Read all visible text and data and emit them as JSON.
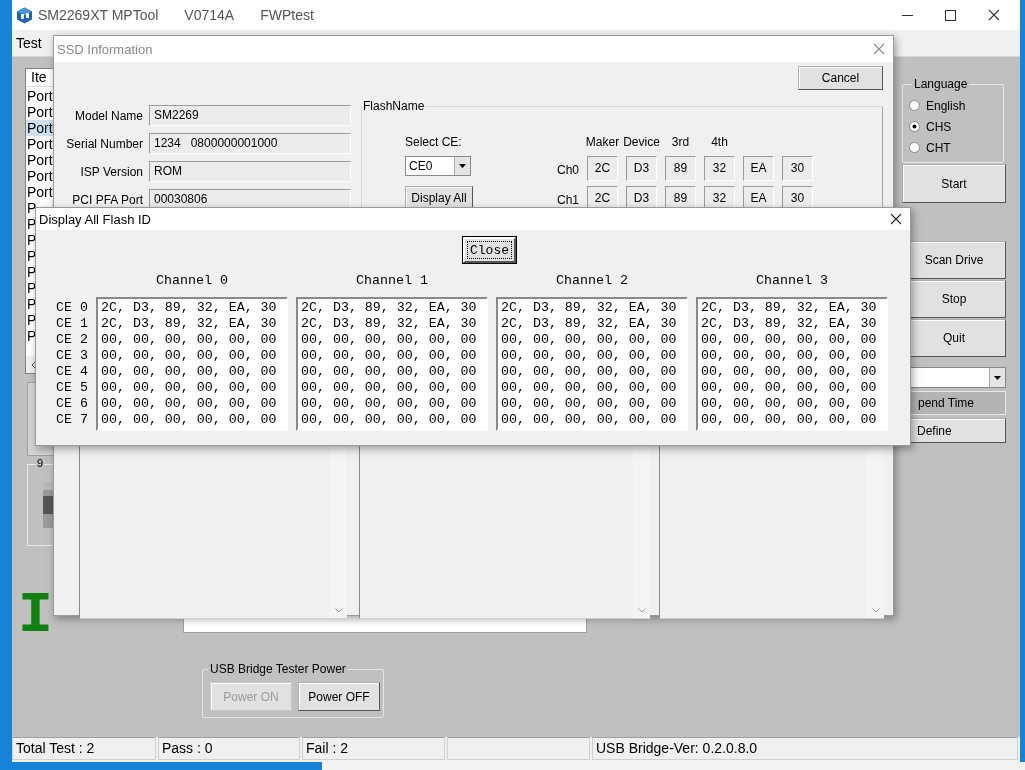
{
  "main_window": {
    "title": "SM2269XT MPTool",
    "version": "V0714A",
    "firmware": "FWPtest",
    "menu": [
      "Test"
    ],
    "port_list": {
      "header": "Ite",
      "rows": [
        {
          "label": "Port",
          "selected": false
        },
        {
          "label": "Port",
          "selected": false
        },
        {
          "label": "Port",
          "selected": true
        },
        {
          "label": "Port",
          "selected": false
        },
        {
          "label": "Port",
          "selected": false
        },
        {
          "label": "Port",
          "selected": false
        },
        {
          "label": "Port",
          "selected": false
        },
        {
          "label": "P",
          "selected": false
        },
        {
          "label": "P",
          "selected": false
        },
        {
          "label": "P",
          "selected": false
        },
        {
          "label": "P",
          "selected": false
        },
        {
          "label": "P",
          "selected": false
        },
        {
          "label": "P",
          "selected": false
        },
        {
          "label": "P",
          "selected": false
        },
        {
          "label": "P",
          "selected": false
        },
        {
          "label": "P",
          "selected": false
        }
      ]
    },
    "slot_group": {
      "label": "9"
    },
    "banner": "I",
    "usb_power": {
      "title": "USB Bridge Tester Power",
      "buttons": [
        {
          "label": "Power ON",
          "disabled": true
        },
        {
          "label": "Power OFF",
          "disabled": false
        }
      ]
    },
    "language": {
      "title": "Language",
      "options": [
        {
          "label": "English",
          "selected": false
        },
        {
          "label": "CHS",
          "selected": true
        },
        {
          "label": "CHT",
          "selected": false
        }
      ]
    },
    "start_button": "Start",
    "buttons": [
      "Scan Drive",
      "Stop",
      "Quit"
    ],
    "spend_time": "pend Time",
    "define_button": "Define"
  },
  "ssd_dialog": {
    "title": "SSD Information",
    "cancel": "Cancel",
    "fields": [
      {
        "label": "Model Name",
        "value": "SM2269"
      },
      {
        "label": "Serial Number",
        "value": "1234   0800000001000"
      },
      {
        "label": "ISP Version",
        "value": "ROM"
      },
      {
        "label": "PCI PFA Port",
        "value": "00030806"
      }
    ],
    "flash_group": {
      "title": "FlashName",
      "select_label": "Select CE:",
      "select_value": "CE0",
      "display_all": "Display All",
      "headers": [
        "Maker",
        "Device",
        "3rd",
        "4th"
      ],
      "rows": [
        {
          "label": "Ch0",
          "cells": [
            "2C",
            "D3",
            "89",
            "32",
            "EA",
            "30"
          ]
        },
        {
          "label": "Ch1",
          "cells": [
            "2C",
            "D3",
            "89",
            "32",
            "EA",
            "30"
          ]
        }
      ]
    }
  },
  "flash_dialog": {
    "title": "Display All Flash ID",
    "close_button": {
      "label": "Close",
      "focused": true
    },
    "ce_labels": [
      "CE 0",
      "CE 1",
      "CE 2",
      "CE 3",
      "CE 4",
      "CE 5",
      "CE 6",
      "CE 7"
    ],
    "channels": [
      {
        "title": "Channel 0",
        "lines": [
          "2C, D3, 89, 32, EA, 30",
          "2C, D3, 89, 32, EA, 30",
          "00, 00, 00, 00, 00, 00",
          "00, 00, 00, 00, 00, 00",
          "00, 00, 00, 00, 00, 00",
          "00, 00, 00, 00, 00, 00",
          "00, 00, 00, 00, 00, 00",
          "00, 00, 00, 00, 00, 00"
        ]
      },
      {
        "title": "Channel 1",
        "lines": [
          "2C, D3, 89, 32, EA, 30",
          "2C, D3, 89, 32, EA, 30",
          "00, 00, 00, 00, 00, 00",
          "00, 00, 00, 00, 00, 00",
          "00, 00, 00, 00, 00, 00",
          "00, 00, 00, 00, 00, 00",
          "00, 00, 00, 00, 00, 00",
          "00, 00, 00, 00, 00, 00"
        ]
      },
      {
        "title": "Channel 2",
        "lines": [
          "2C, D3, 89, 32, EA, 30",
          "2C, D3, 89, 32, EA, 30",
          "00, 00, 00, 00, 00, 00",
          "00, 00, 00, 00, 00, 00",
          "00, 00, 00, 00, 00, 00",
          "00, 00, 00, 00, 00, 00",
          "00, 00, 00, 00, 00, 00",
          "00, 00, 00, 00, 00, 00"
        ]
      },
      {
        "title": "Channel 3",
        "lines": [
          "2C, D3, 89, 32, EA, 30",
          "2C, D3, 89, 32, EA, 30",
          "00, 00, 00, 00, 00, 00",
          "00, 00, 00, 00, 00, 00",
          "00, 00, 00, 00, 00, 00",
          "00, 00, 00, 00, 00, 00",
          "00, 00, 00, 00, 00, 00",
          "00, 00, 00, 00, 00, 00"
        ]
      }
    ]
  },
  "status_bar": [
    "Total Test : 2",
    "Pass : 0",
    "Fail : 2",
    "USB Bridge-Ver: 0.2.0.8.0"
  ]
}
